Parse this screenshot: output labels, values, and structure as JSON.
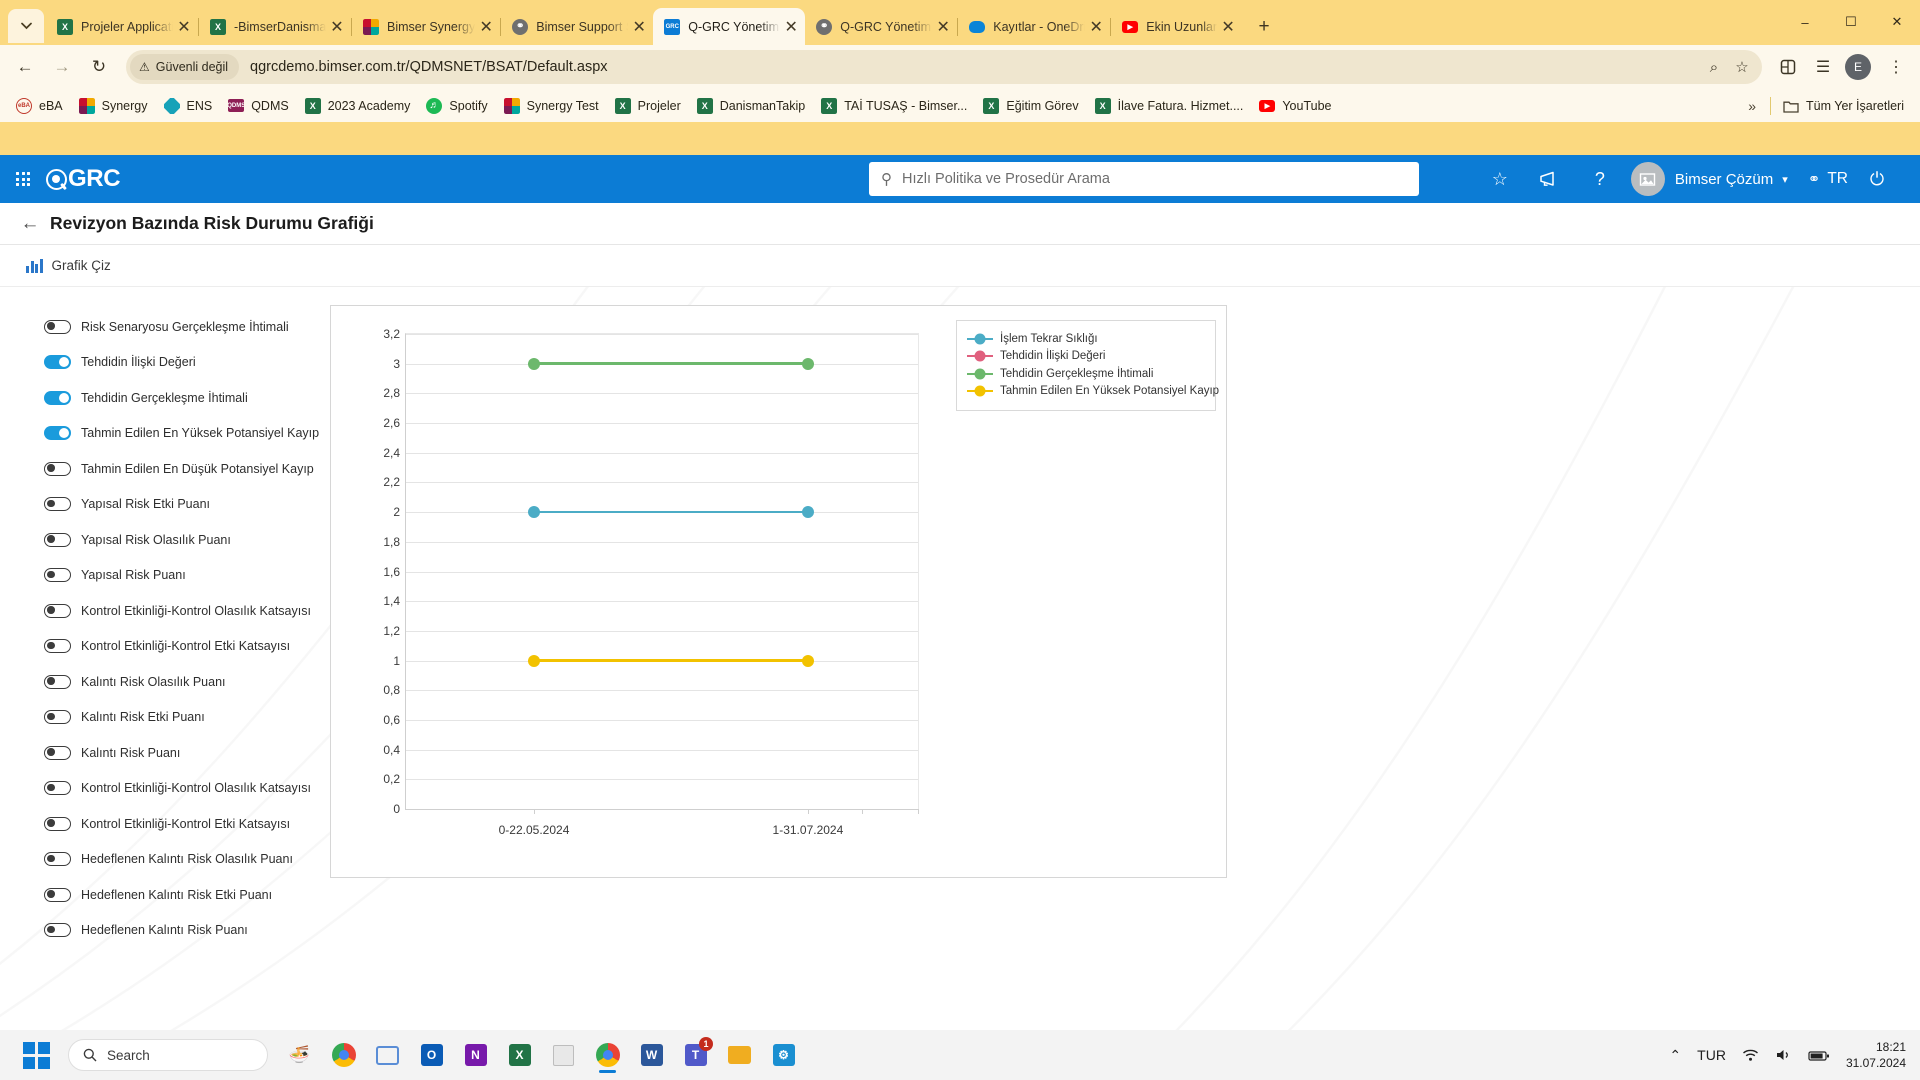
{
  "browser": {
    "tabs": [
      {
        "title": "Projeler Application",
        "favicon": "excel-icon",
        "color": "#217346",
        "active": false
      },
      {
        "title": "-BimserDanismanTakip",
        "favicon": "excel-icon",
        "color": "#217346",
        "active": false
      },
      {
        "title": "Bimser Synergy",
        "favicon": "synergy-icon",
        "color": "#8e1f55",
        "active": false
      },
      {
        "title": "Bimser Support Sistemi",
        "favicon": "globe-icon",
        "color": "#6b6b6b",
        "active": false
      },
      {
        "title": "Q-GRC Yönetim Sistemi",
        "favicon": "qgrc-icon",
        "color": "#0c7cd5",
        "active": true
      },
      {
        "title": "Q-GRC Yönetim Sistemi",
        "favicon": "globe-icon",
        "color": "#6b6b6b",
        "active": false
      },
      {
        "title": "Kayıtlar - OneDrive",
        "favicon": "onedrive-icon",
        "color": "#0a84d8",
        "active": false
      },
      {
        "title": "Ekin Uzunlar",
        "favicon": "youtube-icon",
        "color": "#ff0000",
        "active": false
      }
    ],
    "new_tab_label": "+",
    "window_controls": {
      "minimize": "–",
      "maximize": "☐",
      "close": "✕"
    },
    "toolbar": {
      "back": "back-arrow",
      "forward": "forward-arrow",
      "reload": "reload-icon",
      "security_label": "Güvenli değil",
      "url": "qgrcdemo.bimser.com.tr/QDMSNET/BSAT/Default.aspx",
      "zoom_icon": "zoom-icon",
      "bookmark_star": "star-icon",
      "extensions_icon": "extensions-icon",
      "reading_list_icon": "reading-list-icon",
      "profile_initial": "E",
      "menu_icon": "kebab-menu-icon"
    },
    "bookmarks": [
      {
        "label": "eBA",
        "icon": "eba-icon",
        "color": "#c0392b"
      },
      {
        "label": "Synergy",
        "icon": "synergy-icon",
        "color": "#8e1f55"
      },
      {
        "label": "ENS",
        "icon": "ens-icon",
        "color": "#17a2b8"
      },
      {
        "label": "QDMS",
        "icon": "qdms-icon",
        "color": "#8e1f55"
      },
      {
        "label": "2023 Academy",
        "icon": "excel-icon",
        "color": "#217346"
      },
      {
        "label": "Spotify",
        "icon": "spotify-icon",
        "color": "#1db954"
      },
      {
        "label": "Synergy Test",
        "icon": "synergy-icon",
        "color": "#8e1f55"
      },
      {
        "label": "Projeler",
        "icon": "excel-icon",
        "color": "#217346"
      },
      {
        "label": "DanismanTakip",
        "icon": "excel-icon",
        "color": "#217346"
      },
      {
        "label": "TAİ TUSAŞ - Bimser...",
        "icon": "excel-icon",
        "color": "#217346"
      },
      {
        "label": "Eğitim Görev",
        "icon": "excel-icon",
        "color": "#217346"
      },
      {
        "label": "İlave Fatura. Hizmet....",
        "icon": "excel-icon",
        "color": "#217346"
      },
      {
        "label": "YouTube",
        "icon": "youtube-icon",
        "color": "#ff0000"
      }
    ],
    "bookmarks_overflow": "»",
    "all_bookmarks_label": "Tüm Yer İşaretleri",
    "all_bookmarks_icon": "folder-icon"
  },
  "app": {
    "apps_grid_icon": "apps-grid-icon",
    "brand": "GRC",
    "search": {
      "placeholder": "Hızlı Politika ve Prosedür Arama",
      "icon": "search-icon"
    },
    "header_icons": [
      "star-icon",
      "megaphone-icon",
      "help-icon"
    ],
    "user": {
      "name": "Bimser Çözüm",
      "avatar": "user-avatar",
      "chevron": "⌄"
    },
    "language": {
      "label": "TR",
      "icon": "translate-icon"
    },
    "power_icon": "power-icon",
    "accent_color": "#0c7cd5"
  },
  "page": {
    "back_icon": "back-arrow-icon",
    "title": "Revizyon Bazında Risk Durumu Grafiği",
    "action": {
      "label": "Grafik Çiz",
      "icon": "bar-chart-icon"
    }
  },
  "sidebar": {
    "items": [
      {
        "label": "Risk Senaryosu Gerçekleşme İhtimali",
        "on": false
      },
      {
        "label": "Tehdidin İlişki Değeri",
        "on": true
      },
      {
        "label": "Tehdidin Gerçekleşme İhtimali",
        "on": true
      },
      {
        "label": "Tahmin Edilen En Yüksek Potansiyel Kayıp",
        "on": true
      },
      {
        "label": "Tahmin Edilen En Düşük Potansiyel Kayıp",
        "on": false
      },
      {
        "label": "Yapısal Risk Etki Puanı",
        "on": false
      },
      {
        "label": "Yapısal Risk Olasılık Puanı",
        "on": false
      },
      {
        "label": "Yapısal Risk Puanı",
        "on": false
      },
      {
        "label": "Kontrol Etkinliği-Kontrol Olasılık Katsayısı",
        "on": false
      },
      {
        "label": "Kontrol Etkinliği-Kontrol Etki Katsayısı",
        "on": false
      },
      {
        "label": "Kalıntı Risk Olasılık Puanı",
        "on": false
      },
      {
        "label": "Kalıntı Risk Etki Puanı",
        "on": false
      },
      {
        "label": "Kalıntı Risk Puanı",
        "on": false
      },
      {
        "label": "Kontrol Etkinliği-Kontrol Olasılık Katsayısı",
        "on": false
      },
      {
        "label": "Kontrol Etkinliği-Kontrol Etki Katsayısı",
        "on": false
      },
      {
        "label": "Hedeflenen Kalıntı Risk Olasılık Puanı",
        "on": false
      },
      {
        "label": "Hedeflenen Kalıntı Risk Etki Puanı",
        "on": false
      },
      {
        "label": "Hedeflenen Kalıntı Risk Puanı",
        "on": false
      }
    ]
  },
  "chart_data": {
    "type": "line",
    "title": "",
    "xlabel": "",
    "ylabel": "",
    "grid": true,
    "legend_position": "right",
    "x": [
      "0-22.05.2024",
      "1-31.07.2024"
    ],
    "ylim": [
      0,
      3.2
    ],
    "ytick_step": 0.2,
    "yticks": [
      "0",
      "0,2",
      "0,4",
      "0,6",
      "0,8",
      "1",
      "1,2",
      "1,4",
      "1,6",
      "1,8",
      "2",
      "2,2",
      "2,4",
      "2,6",
      "2,8",
      "3",
      "3,2"
    ],
    "series": [
      {
        "name": "İşlem Tekrar Sıklığı",
        "color": "#4bacc6",
        "values": [
          2,
          2
        ]
      },
      {
        "name": "Tehdidin İlişki Değeri",
        "color": "#e0607e",
        "values": [
          null,
          null
        ]
      },
      {
        "name": "Tehdidin Gerçekleşme İhtimali",
        "color": "#6cb86c",
        "values": [
          3,
          3
        ]
      },
      {
        "name": "Tahmin Edilen En Yüksek Potansiyel Kayıp",
        "color": "#f2c200",
        "values": [
          1,
          1
        ]
      }
    ]
  },
  "taskbar": {
    "start_icon": "windows-start-icon",
    "search_placeholder": "Search",
    "search_icon": "search-icon",
    "apps": [
      {
        "name": "widgets-icon",
        "color": "#d9a13b",
        "active": false
      },
      {
        "name": "chrome-pre-icon",
        "color": "#4285f4",
        "active": false
      },
      {
        "name": "task-view-icon",
        "color": "#5a8dd6",
        "active": false
      },
      {
        "name": "outlook-icon",
        "color": "#0a5bb5",
        "active": false
      },
      {
        "name": "onenote-icon",
        "color": "#7719aa",
        "active": false
      },
      {
        "name": "excel-icon",
        "color": "#217346",
        "active": false
      },
      {
        "name": "notepad-icon",
        "color": "#6b6b6b",
        "active": false
      },
      {
        "name": "chrome-icon",
        "color": "#4285f4",
        "active": true
      },
      {
        "name": "word-icon",
        "color": "#2b579a",
        "active": false
      },
      {
        "name": "teams-icon",
        "color": "#5059c9",
        "active": false,
        "badge": "1"
      },
      {
        "name": "file-explorer-icon",
        "color": "#f0ad20",
        "active": false
      },
      {
        "name": "app-icon",
        "color": "#1a8fd1",
        "active": false
      }
    ],
    "tray": {
      "chevron": "⌃",
      "language": "TUR",
      "wifi_icon": "wifi-icon",
      "volume_icon": "volume-icon",
      "battery_icon": "battery-icon",
      "time": "18:21",
      "date": "31.07.2024"
    }
  }
}
